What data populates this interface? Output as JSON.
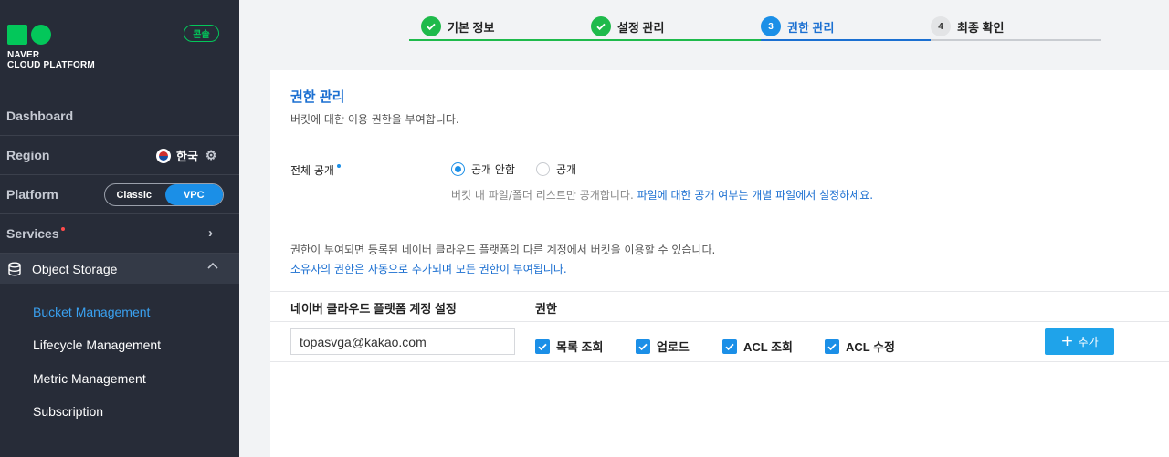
{
  "logo": {
    "line1": "NAVER",
    "line2": "CLOUD PLATFORM"
  },
  "console_badge": "콘솔",
  "nav": {
    "dashboard": "Dashboard",
    "region": {
      "label": "Region",
      "value": "한국"
    },
    "platform": {
      "label": "Platform",
      "options": [
        "Classic",
        "VPC"
      ],
      "selected": "VPC"
    },
    "services": "Services",
    "object_storage": "Object Storage",
    "sub_items": [
      "Bucket Management",
      "Lifecycle Management",
      "Metric Management",
      "Subscription"
    ]
  },
  "steps": [
    {
      "num": "1",
      "label": "기본 정보",
      "state": "done"
    },
    {
      "num": "2",
      "label": "설정 관리",
      "state": "done"
    },
    {
      "num": "3",
      "label": "권한 관리",
      "state": "current"
    },
    {
      "num": "4",
      "label": "최종 확인",
      "state": "todo"
    }
  ],
  "panel": {
    "title": "권한 관리",
    "subtitle": "버킷에 대한 이용 권한을 부여합니다.",
    "public_label": "전체 공개",
    "radio_off": "공개 안함",
    "radio_on": "공개",
    "hint_text": "버킷 내 파일/폴더 리스트만 공개합니다. ",
    "hint_link": "파일에 대한 공개 여부는 개별 파일에서 설정하세요.",
    "info_line1": "권한이 부여되면 등록된 네이버 클라우드 플랫폼의 다른 계정에서 버킷을 이용할 수 있습니다.",
    "info_line2": "소유자의 권한은 자동으로 추가되며 모든 권한이 부여됩니다.",
    "col_account": "네이버 클라우드 플랫폼 계정 설정",
    "col_permission": "권한",
    "account_value": "topasvga@kakao.com",
    "permissions": [
      "목록 조회",
      "업로드",
      "ACL 조회",
      "ACL 수정"
    ],
    "add_label": "추가"
  },
  "colors": {
    "accent": "#1b8fe7",
    "done": "#1fba4b",
    "sidebar_bg": "#272c38"
  }
}
